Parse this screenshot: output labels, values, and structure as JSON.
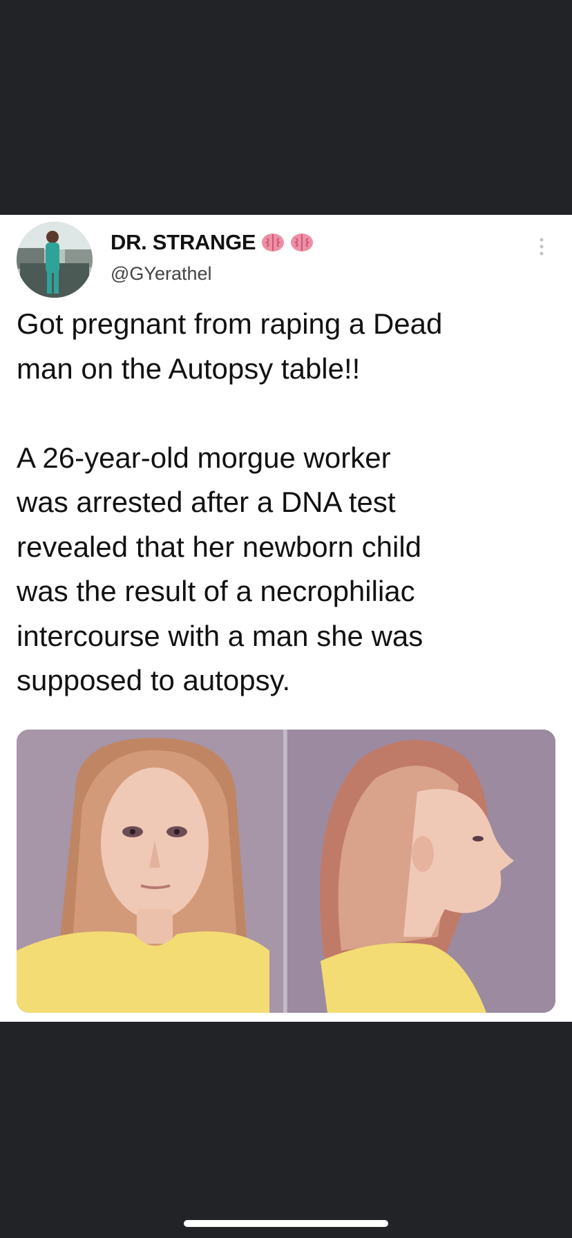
{
  "tweet": {
    "display_name": "DR. STRANGE",
    "name_emoji": [
      "brain-emoji",
      "brain-emoji"
    ],
    "handle": "@GYerathel",
    "text": {
      "headline_line1": "Got pregnant from raping a Dead",
      "headline_line2": "man on the Autopsy table!!",
      "body_line1": "A 26-year-old morgue worker",
      "body_line2": "was arrested after a DNA test",
      "body_line3": "revealed that her newborn child",
      "body_line4": "was the result of a necrophiliac",
      "body_line5": "intercourse with a man she was",
      "body_line6": "supposed to autopsy."
    },
    "media": {
      "type": "photo",
      "panels": [
        "front-view",
        "side-profile-view"
      ]
    }
  },
  "icons": {
    "more": "vertical-ellipsis-icon"
  },
  "colors": {
    "background": "#222327",
    "card": "#ffffff",
    "text": "#111111",
    "handle": "#444444",
    "emoji_pink": "#ee8fa6",
    "media_backdrop": "#a795a8",
    "shirt_yellow": "#f3dc73"
  }
}
